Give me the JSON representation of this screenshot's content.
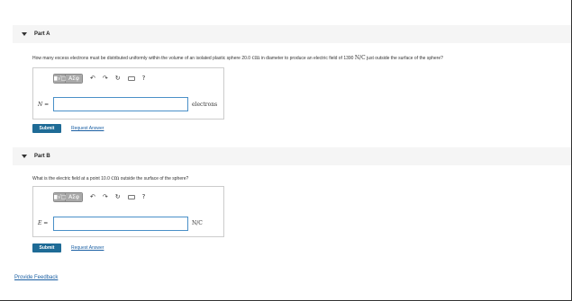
{
  "part_a": {
    "title": "Part A",
    "question_before": "How many excess electrons must be distributed uniformly within the volume of an isolated plastic sphere 20.0 ",
    "question_unit1": "cm",
    "question_middle": " in diameter to produce an electric field of 1390 ",
    "question_unit2": "N/C",
    "question_after": " just outside the surface of the sphere?",
    "variable": "N",
    "equals": " =",
    "unit": "electrons",
    "input_value": "",
    "submit_label": "Submit",
    "request_answer_label": "Request Answer"
  },
  "part_b": {
    "title": "Part B",
    "question_before": "What is the electric field at a point 10.0 ",
    "question_unit1": "cm",
    "question_after": " outside the surface of the sphere?",
    "variable": "E",
    "equals": " =",
    "unit": "N/C",
    "input_value": "",
    "submit_label": "Submit",
    "request_answer_label": "Request Answer"
  },
  "toolbar": {
    "template_glyph": "■√□",
    "symbols_glyph": "ΑΣφ",
    "undo_glyph": "↶",
    "redo_glyph": "↷",
    "reset_glyph": "↻",
    "help_glyph": "?"
  },
  "footer": {
    "feedback_label": "Provide Feedback"
  }
}
